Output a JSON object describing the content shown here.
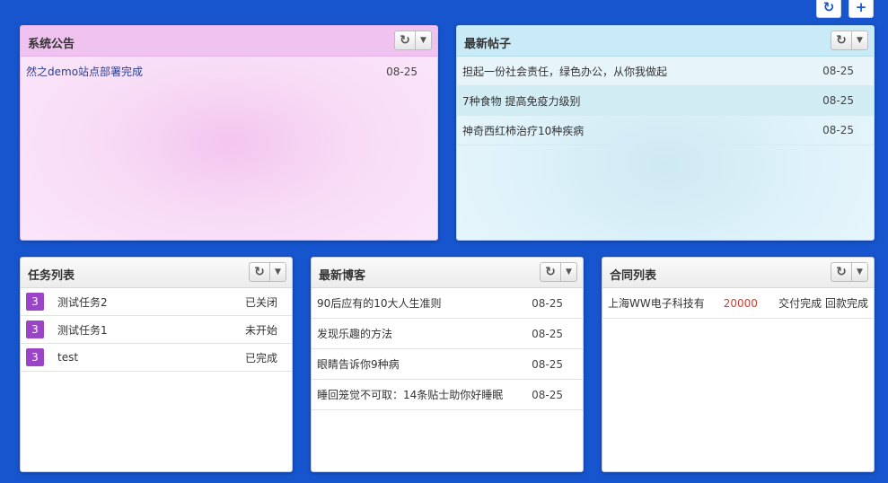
{
  "top_tools": {
    "refresh_icon": "↻",
    "add_icon": "+"
  },
  "panel_icons": {
    "refresh": "↻",
    "caret": "▼"
  },
  "notice": {
    "title": "系统公告",
    "items": [
      {
        "title": "然之demo站点部署完成",
        "date": "08-25"
      }
    ]
  },
  "posts": {
    "title": "最新帖子",
    "items": [
      {
        "title": "担起一份社会责任，绿色办公，从你我做起",
        "date": "08-25"
      },
      {
        "title": "7种食物 提高免疫力级别",
        "date": "08-25"
      },
      {
        "title": "神奇西红柿治疗10种疾病",
        "date": "08-25"
      }
    ]
  },
  "tasks": {
    "title": "任务列表",
    "items": [
      {
        "priority": "3",
        "name": "测试任务2",
        "status": "已关闭"
      },
      {
        "priority": "3",
        "name": "测试任务1",
        "status": "未开始"
      },
      {
        "priority": "3",
        "name": "test",
        "status": "已完成"
      }
    ]
  },
  "blogs": {
    "title": "最新博客",
    "items": [
      {
        "title": "90后应有的10大人生准则",
        "date": "08-25"
      },
      {
        "title": "发现乐趣的方法",
        "date": "08-25"
      },
      {
        "title": "眼睛告诉你9种病",
        "date": "08-25"
      },
      {
        "title": "睡回笼觉不可取：14条贴士助你好睡眠",
        "date": "08-25"
      }
    ]
  },
  "contracts": {
    "title": "合同列表",
    "items": [
      {
        "name": "上海WW电子科技有",
        "amount": "20000",
        "delivery": "交付完成",
        "payment": "回款完成"
      }
    ]
  },
  "colors": {
    "background": "#1755cf",
    "priority_badge": "#9b44c8",
    "amount": "#d23a2f"
  }
}
